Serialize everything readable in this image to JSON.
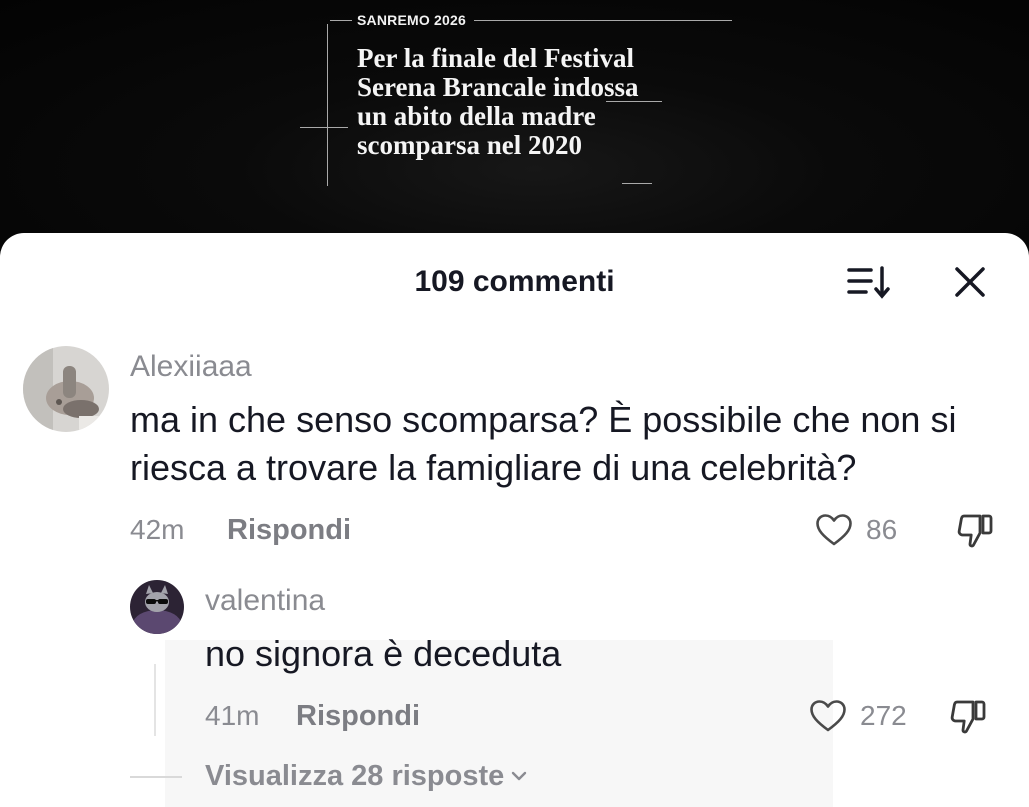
{
  "video_overlay": {
    "kicker": "SANREMO 2026",
    "headline_lines": [
      "Per la finale del Festival",
      "Serena Brancale indossa",
      "un abito della madre",
      "scomparsa nel 2020"
    ]
  },
  "panel": {
    "title": "109 commenti",
    "icons": {
      "sort": "sort-icon",
      "close": "close-icon"
    }
  },
  "comments": [
    {
      "username": "Alexiiaaa",
      "text": "ma in che senso scomparsa? È possibile che non si riesca a trovare la famigliare di una celebrità?",
      "time": "42m",
      "reply_label": "Rispondi",
      "likes": "86",
      "view_replies_label": "Visualizza 28 risposte",
      "replies": [
        {
          "username": "valentina",
          "text": "no signora è deceduta",
          "time": "41m",
          "reply_label": "Rispondi",
          "likes": "272"
        }
      ]
    }
  ],
  "icons": {
    "like": "heart-icon",
    "dislike": "thumbs-down-icon",
    "expand": "chevron-down-icon"
  },
  "colors": {
    "text_primary": "#161823",
    "text_secondary": "#8a8b91",
    "icon_stroke": "#4a4a4a",
    "panel_background": "#ffffff",
    "video_background": "#050505"
  }
}
